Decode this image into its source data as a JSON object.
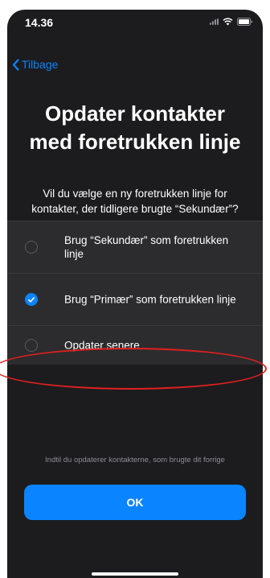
{
  "status_bar": {
    "time": "14.36",
    "icons": [
      "signal-icon",
      "wifi-icon",
      "battery-icon"
    ]
  },
  "nav": {
    "back_label": "Tilbage",
    "back_icon": "chevron-left-icon"
  },
  "header": {
    "title": "Opdater kontakter med foretrukken linje",
    "subtitle": "Vil du vælge en ny foretrukken linje for kontakter, der tidligere brugte “Sekundær”?"
  },
  "options": [
    {
      "label": "Brug “Sekundær” som foretrukken linje",
      "selected": false
    },
    {
      "label": "Brug “Primær” som foretrukken linje",
      "selected": true
    },
    {
      "label": "Opdater senere",
      "selected": false
    }
  ],
  "footnote": "Indtil du opdaterer kontakterne, som brugte dit forrige",
  "primary_button": {
    "label": "OK"
  },
  "colors": {
    "background": "#1c1c1e",
    "row_background": "#2c2c2e",
    "accent": "#0a84ff",
    "annotation": "#e02020"
  }
}
